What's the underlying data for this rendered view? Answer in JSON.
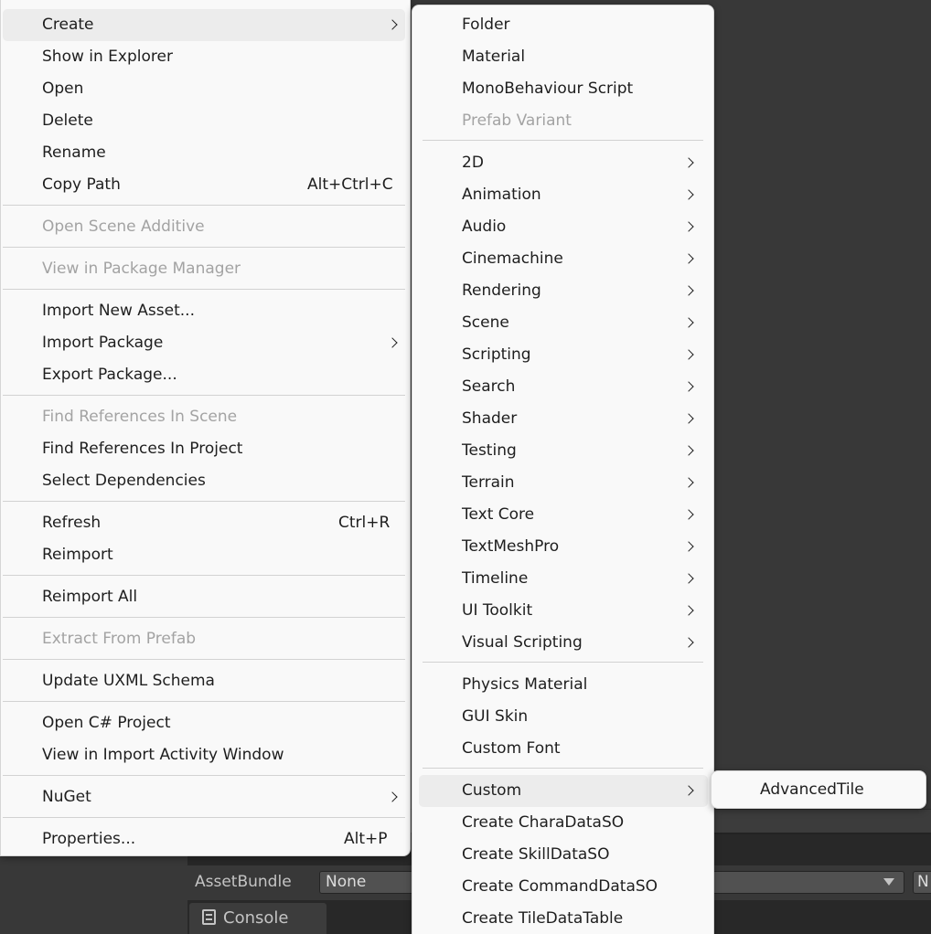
{
  "background": {
    "assetbundle_label": "AssetBundle",
    "assetbundle_value": "None",
    "assetbundle_variant_value": "N",
    "console_tab_label": "Console"
  },
  "main_menu": {
    "create": "Create",
    "show_in_explorer": "Show in Explorer",
    "open": "Open",
    "delete": "Delete",
    "rename": "Rename",
    "copy_path": "Copy Path",
    "copy_path_shortcut": "Alt+Ctrl+C",
    "open_scene_additive": "Open Scene Additive",
    "view_in_package_manager": "View in Package Manager",
    "import_new_asset": "Import New Asset...",
    "import_package": "Import Package",
    "export_package": "Export Package...",
    "find_references_in_scene": "Find References In Scene",
    "find_references_in_project": "Find References In Project",
    "select_dependencies": "Select Dependencies",
    "refresh": "Refresh",
    "refresh_shortcut": "Ctrl+R",
    "reimport": "Reimport",
    "reimport_all": "Reimport All",
    "extract_from_prefab": "Extract From Prefab",
    "update_uxml_schema": "Update UXML Schema",
    "open_csharp_project": "Open C# Project",
    "view_in_import_activity_window": "View in Import Activity Window",
    "nuget": "NuGet",
    "properties": "Properties...",
    "properties_shortcut": "Alt+P"
  },
  "create_menu": {
    "folder": "Folder",
    "material": "Material",
    "monobehaviour_script": "MonoBehaviour Script",
    "prefab_variant": "Prefab Variant",
    "submenus": [
      "2D",
      "Animation",
      "Audio",
      "Cinemachine",
      "Rendering",
      "Scene",
      "Scripting",
      "Search",
      "Shader",
      "Testing",
      "Terrain",
      "Text Core",
      "TextMeshPro",
      "Timeline",
      "UI Toolkit",
      "Visual Scripting"
    ],
    "physics_material": "Physics Material",
    "gui_skin": "GUI Skin",
    "custom_font": "Custom Font",
    "custom": "Custom",
    "create_charadataso": "Create CharaDataSO",
    "create_skilldataso": "Create SkillDataSO",
    "create_commanddataso": "Create CommandDataSO",
    "create_tiledatatable": "Create TileDataTable"
  },
  "custom_menu": {
    "advanced_tile": "AdvancedTile"
  }
}
